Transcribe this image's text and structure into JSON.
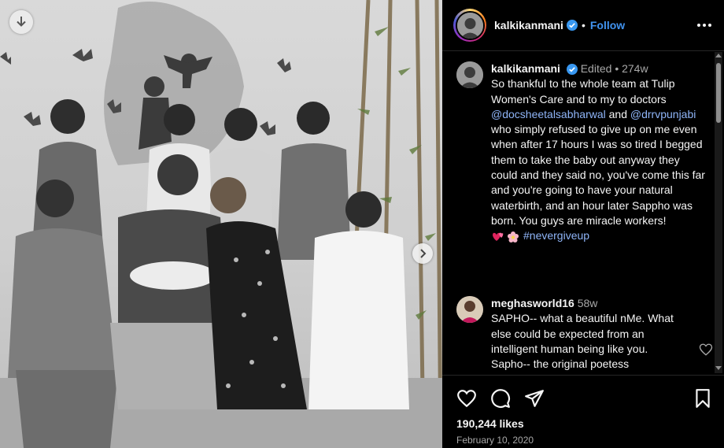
{
  "post": {
    "username": "kalkikanmani",
    "follow_label": "Follow",
    "dot": "•"
  },
  "caption": {
    "username": "kalkikanmani",
    "edited": "Edited",
    "sep": "•",
    "age": "274w",
    "text_1": "So thankful to the whole team at Tulip Women's Care and to my to doctors ",
    "mention_1": "@docsheetalsabharwal",
    "text_2": " and ",
    "mention_2": "@drrvpunjabi",
    "text_3": " who simply refused to give up on me even when after 17 hours I was so tired I begged them to take the baby out anyway they could and they said no, you've come this far and you're going to have your natural waterbirth, and an hour later Sappho was born. You guys are miracle workers!",
    "emojis": [
      "two-hearts",
      "blossom"
    ],
    "hashtag": "#nevergiveup"
  },
  "comment": {
    "username": "meghasworld16",
    "age": "58w",
    "text": "SAPHO-- what a beautiful nMe. What else could be expected from an intelligent human being like you. Sapho-- the original poetess"
  },
  "stats": {
    "likes": "190,244 likes",
    "date": "February 10, 2020"
  },
  "icons": {
    "download": "arrow-down-icon",
    "next": "chevron-right-icon",
    "more": "more-options-icon",
    "like": "heart-icon",
    "comment": "comment-icon",
    "share": "share-icon",
    "save": "bookmark-icon"
  },
  "colors": {
    "background": "#000000",
    "link": "#4193ef",
    "mention": "#8fb5f8",
    "muted": "#a8a8a8",
    "verified": "#3897f0"
  }
}
